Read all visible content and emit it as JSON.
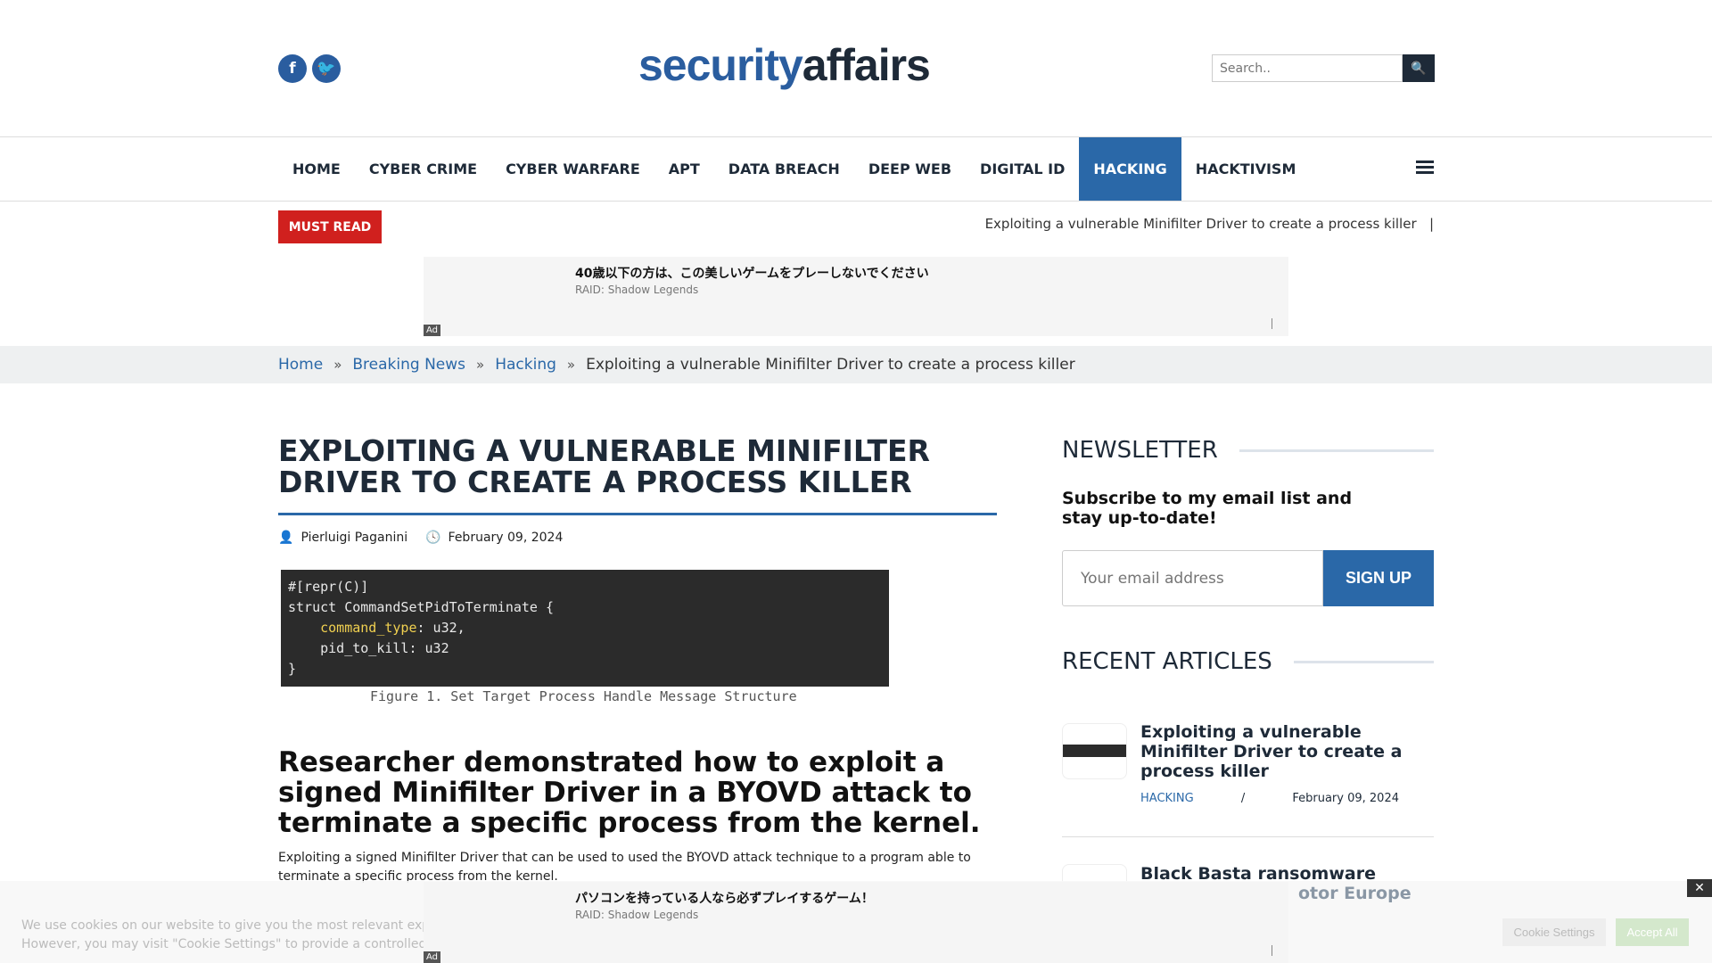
{
  "header": {
    "logo": "securityaffairs",
    "logo_part1": "security",
    "logo_part2": "affairs",
    "social": [
      {
        "icon": "facebook-icon",
        "glyph": "f"
      },
      {
        "icon": "twitter-icon",
        "glyph": "t"
      }
    ],
    "search_placeholder": "Search..",
    "search_icon": "🔍"
  },
  "nav": {
    "items": [
      "HOME",
      "CYBER CRIME",
      "CYBER WARFARE",
      "APT",
      "DATA BREACH",
      "DEEP WEB",
      "DIGITAL ID",
      "HACKING",
      "HACKTIVISM"
    ],
    "active": "HACKING",
    "accent": "#2a68a8"
  },
  "ticker": {
    "must_read": "MUST READ",
    "headline": "Exploiting a vulnerable Minifilter Driver to create a process killer",
    "sep": "|"
  },
  "ad_top": {
    "title": "40歳以下の方は、この美しいゲームをプレーしないでください",
    "sponsor": "RAID: Shadow Legends",
    "tag": "Ad"
  },
  "breadcrumb": {
    "items": [
      "Home",
      "Breaking News",
      "Hacking"
    ],
    "current": "Exploiting a vulnerable Minifilter Driver to create a process killer",
    "sep": "»"
  },
  "article": {
    "title": "EXPLOITING A VULNERABLE MINIFILTER DRIVER TO CREATE A PROCESS KILLER",
    "author": "Pierluigi Paganini",
    "date": "February 09, 2024",
    "code": [
      "#[repr(C)]",
      "struct CommandSetPidToTerminate {",
      "command_type",
      "pid_to_kill: u32",
      "}"
    ],
    "code_suffix1": ": u32,",
    "caption": "Figure 1. Set Target Process Handle Message Structure",
    "subtitle": "Researcher demonstrated how to exploit a signed Minifilter Driver in a BYOVD attack to terminate a specific process from the kernel.",
    "body": "Exploiting a signed Minifilter Driver that can be used to used the BYOVD attack technique to a program able to terminate a specific process from the kernel."
  },
  "sidebar": {
    "newsletter_heading": "NEWSLETTER",
    "newsletter_text": "Subscribe to my email list and stay up-to-date!",
    "email_placeholder": "Your email address",
    "signup": "SIGN UP",
    "recent_heading": "RECENT ARTICLES",
    "recent": [
      {
        "title": "Exploiting a vulnerable Minifilter Driver to create a process killer",
        "category": "HACKING",
        "sep": "/",
        "date": "February 09, 2024"
      },
      {
        "title": "Black Basta ransomware gang",
        "title_line2": "otor Europe"
      }
    ]
  },
  "ad_bottom": {
    "title": "パソコンを持っている人なら必ずプレイするゲーム！",
    "sponsor": "RAID: Shadow Legends",
    "tag": "Ad",
    "close": "✕"
  },
  "cookie": {
    "line1": "We use cookies on our website to give you the most relevant expe",
    "line2": "However, you may visit \"Cookie Settings\" to provide a controlled co",
    "settings": "Cookie Settings",
    "accept": "Accept All"
  }
}
